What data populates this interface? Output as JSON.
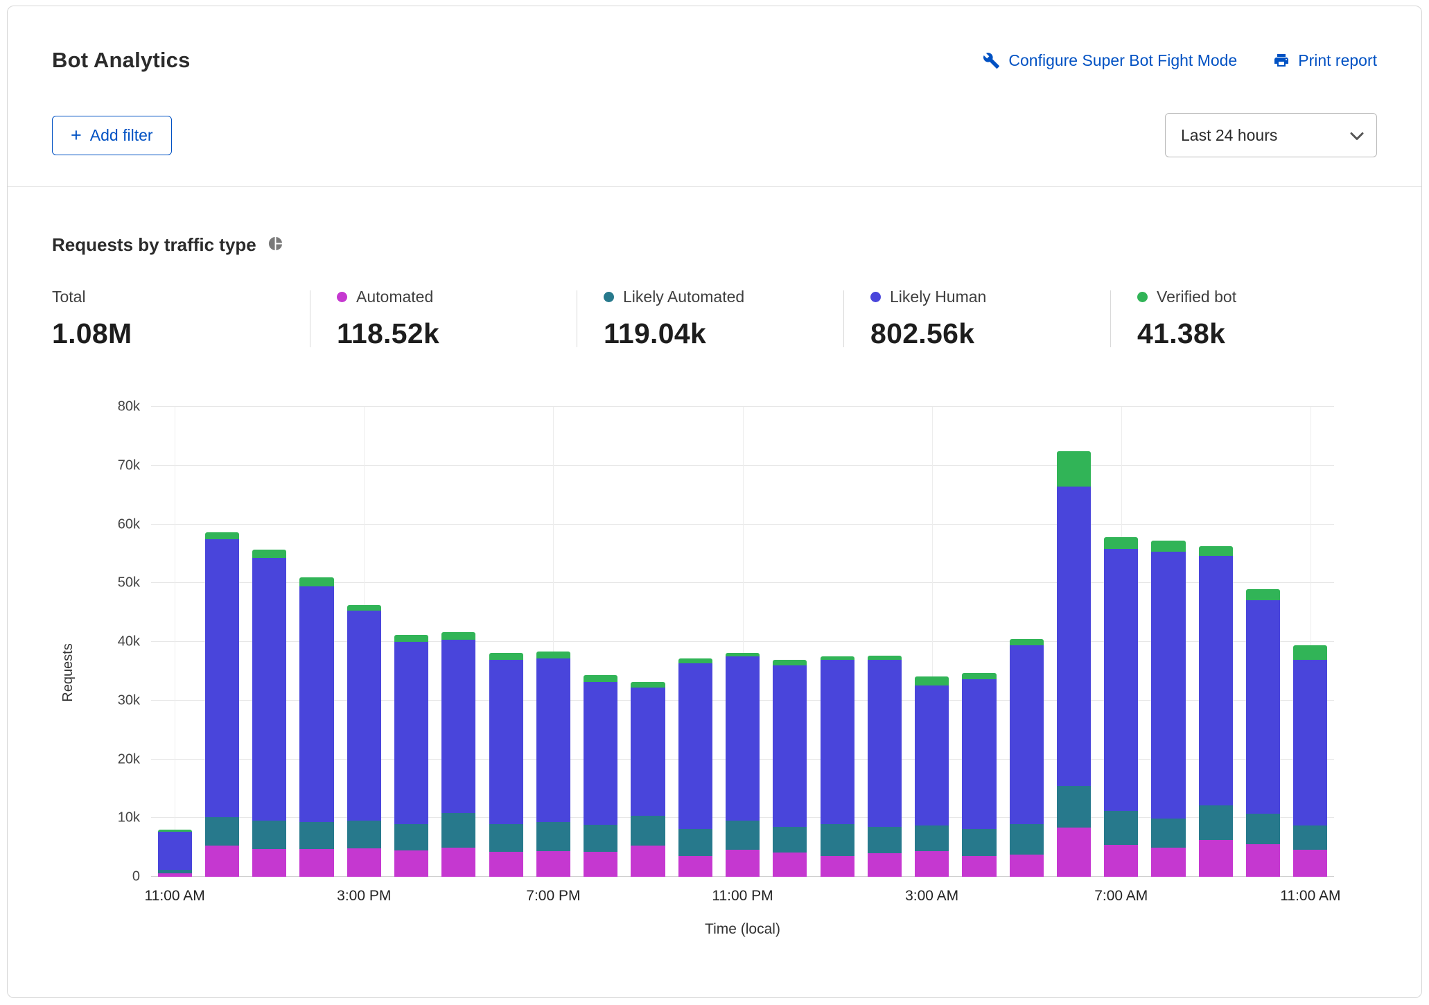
{
  "header": {
    "title": "Bot Analytics",
    "configure_link": "Configure Super Bot Fight Mode",
    "print_link": "Print report"
  },
  "filters": {
    "add_filter_label": "Add filter",
    "time_range_value": "Last 24 hours"
  },
  "section": {
    "title": "Requests by traffic type"
  },
  "icons": {
    "configure": "wrench",
    "print": "printer",
    "section": "pie-chart",
    "time_range": "chevron-down",
    "add_filter": "plus"
  },
  "colors": {
    "link_blue": "#0051c3",
    "automated": "#C538D0",
    "likely_automated": "#27798C",
    "likely_human": "#4945DB",
    "verified_bot": "#31B457"
  },
  "stats": [
    {
      "label": "Total",
      "value": "1.08M",
      "color": null
    },
    {
      "label": "Automated",
      "value": "118.52k",
      "color": "#C538D0"
    },
    {
      "label": "Likely Automated",
      "value": "119.04k",
      "color": "#27798C"
    },
    {
      "label": "Likely Human",
      "value": "802.56k",
      "color": "#4945DB"
    },
    {
      "label": "Verified bot",
      "value": "41.38k",
      "color": "#31B457"
    }
  ],
  "chart_data": {
    "type": "bar",
    "stacked": true,
    "title": "Requests by traffic type",
    "xlabel": "Time (local)",
    "ylabel": "Requests",
    "ylim": [
      0,
      80000
    ],
    "yticks": [
      0,
      10000,
      20000,
      30000,
      40000,
      50000,
      60000,
      70000,
      80000
    ],
    "ytick_labels": [
      "0",
      "10k",
      "20k",
      "30k",
      "40k",
      "50k",
      "60k",
      "70k",
      "80k"
    ],
    "grid": true,
    "legend_position": "top",
    "x": [
      "11:00 AM",
      "12:00 PM",
      "1:00 PM",
      "2:00 PM",
      "3:00 PM",
      "4:00 PM",
      "5:00 PM",
      "6:00 PM",
      "7:00 PM",
      "8:00 PM",
      "9:00 PM",
      "10:00 PM",
      "11:00 PM",
      "12:00 AM",
      "1:00 AM",
      "2:00 AM",
      "3:00 AM",
      "4:00 AM",
      "5:00 AM",
      "6:00 AM",
      "7:00 AM",
      "8:00 AM",
      "9:00 AM",
      "10:00 AM",
      "11:00 AM"
    ],
    "xtick_indices": [
      0,
      4,
      8,
      12,
      16,
      20,
      24
    ],
    "xtick_labels": [
      "11:00 AM",
      "3:00 PM",
      "7:00 PM",
      "11:00 PM",
      "3:00 AM",
      "7:00 AM",
      "11:00 AM"
    ],
    "series": [
      {
        "name": "Automated",
        "color": "#C538D0",
        "values": [
          600,
          5300,
          4700,
          4700,
          4800,
          4500,
          4900,
          4200,
          4400,
          4300,
          5300,
          3600,
          4600,
          4100,
          3600,
          4000,
          4400,
          3600,
          3800,
          8400,
          5400,
          4900,
          6300,
          5600,
          4600
        ]
      },
      {
        "name": "Likely Automated",
        "color": "#27798C",
        "values": [
          600,
          4800,
          4900,
          4600,
          4800,
          4500,
          6000,
          4800,
          4900,
          4500,
          5100,
          4500,
          5000,
          4400,
          5400,
          4500,
          4300,
          4500,
          5200,
          7100,
          5800,
          5000,
          5900,
          5100,
          4100
        ]
      },
      {
        "name": "Likely Human",
        "color": "#4945DB",
        "values": [
          6500,
          47400,
          44700,
          40200,
          35700,
          31000,
          29400,
          27900,
          27900,
          24400,
          21800,
          28200,
          27900,
          27500,
          27900,
          28400,
          23900,
          25500,
          30400,
          50900,
          44600,
          45400,
          42400,
          36400,
          28200
        ]
      },
      {
        "name": "Verified bot",
        "color": "#31B457",
        "values": [
          300,
          1100,
          1400,
          1500,
          1000,
          1200,
          1400,
          1200,
          1200,
          1100,
          1000,
          900,
          600,
          900,
          600,
          800,
          1500,
          1100,
          1100,
          6000,
          2000,
          1900,
          1700,
          1900,
          2500
        ]
      }
    ]
  }
}
